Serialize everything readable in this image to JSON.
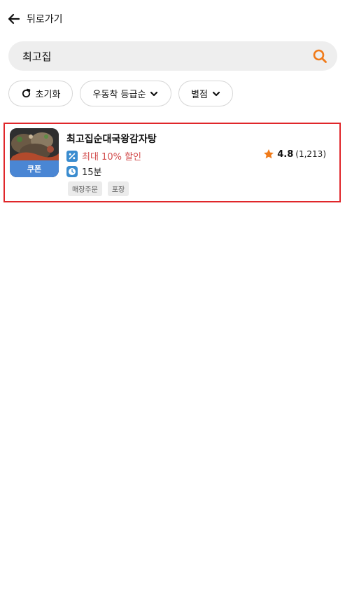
{
  "header": {
    "back_label": "뒤로가기"
  },
  "search": {
    "query": "최고집"
  },
  "filters": {
    "reset_label": "초기화",
    "sort_label": "우동착 등급순",
    "rating_label": "별점"
  },
  "results": [
    {
      "name": "최고집순대국왕감자탕",
      "coupon_label": "쿠폰",
      "discount": "최대 10% 할인",
      "time": "15분",
      "rating": "4.8",
      "review_count": "(1,213)",
      "tags": [
        "매장주문",
        "포장"
      ]
    }
  ],
  "colors": {
    "accent": "#f07b1a",
    "discount_red": "#d24b4b",
    "icon_blue": "#3a8ccf",
    "highlight_border": "#e0262a"
  }
}
